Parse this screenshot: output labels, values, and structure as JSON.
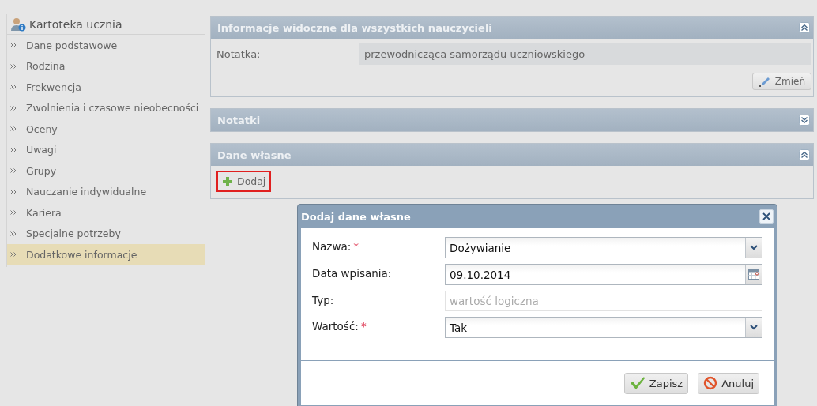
{
  "sidebar": {
    "title": "Kartoteka ucznia",
    "items": [
      {
        "label": "Dane podstawowe",
        "selected": false
      },
      {
        "label": "Rodzina",
        "selected": false
      },
      {
        "label": "Frekwencja",
        "selected": false
      },
      {
        "label": "Zwolnienia i czasowe nieobecności",
        "selected": false
      },
      {
        "label": "Oceny",
        "selected": false
      },
      {
        "label": "Uwagi",
        "selected": false
      },
      {
        "label": "Grupy",
        "selected": false
      },
      {
        "label": "Nauczanie indywidualne",
        "selected": false
      },
      {
        "label": "Kariera",
        "selected": false
      },
      {
        "label": "Specjalne potrzeby",
        "selected": false
      },
      {
        "label": "Dodatkowe informacje",
        "selected": true
      }
    ]
  },
  "panels": [
    {
      "title": "Informacje widoczne dla wszystkich nauczycieli",
      "expanded": true,
      "kind": "note",
      "label": "Notatka:",
      "value": "przewodnicząca samorządu uczniowskiego",
      "button": "Zmień"
    },
    {
      "title": "Notatki",
      "expanded": false
    },
    {
      "title": "Dane własne",
      "expanded": true,
      "kind": "add",
      "button": "Dodaj",
      "highlighted": true
    }
  ],
  "dialog": {
    "title": "Dodaj dane własne",
    "fields": [
      {
        "label": "Nazwa:",
        "required_mark": "*",
        "kind": "select",
        "value": "Dożywianie"
      },
      {
        "label": "Data wpisania:",
        "kind": "date",
        "value": "09.10.2014"
      },
      {
        "label": "Typ:",
        "kind": "text",
        "value": "wartość logiczna",
        "disabled": true
      },
      {
        "label": "Wartość:",
        "required_mark": "*",
        "kind": "select",
        "value": "Tak"
      }
    ],
    "buttons": [
      {
        "label": "Zapisz",
        "kind": "save"
      },
      {
        "label": "Anuluj",
        "kind": "cancel"
      }
    ]
  }
}
